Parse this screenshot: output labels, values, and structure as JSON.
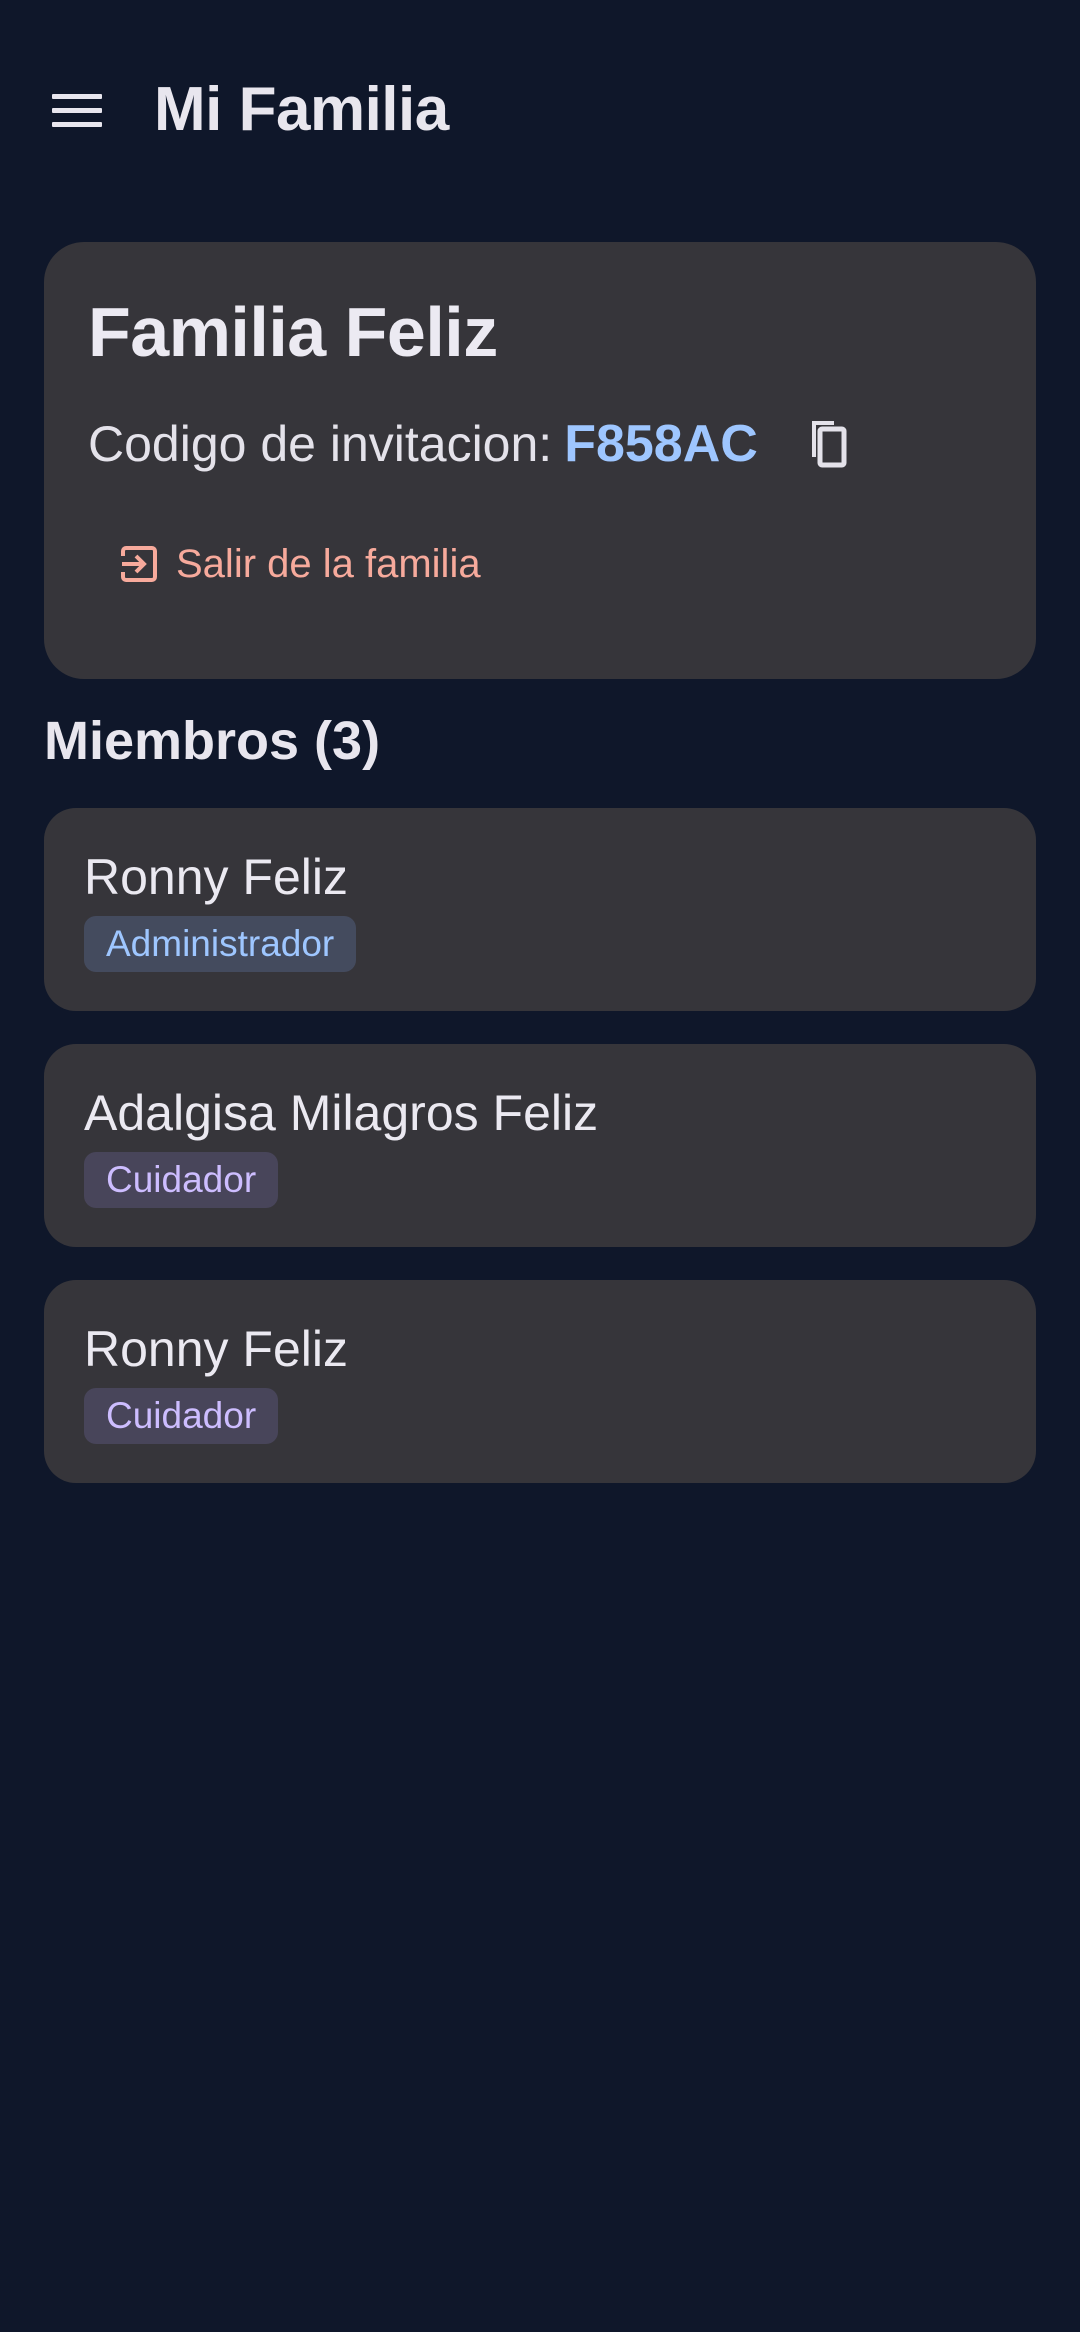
{
  "app_bar": {
    "menu_icon": "menu-icon",
    "title": "Mi Familia"
  },
  "family": {
    "name": "Familia Feliz",
    "invite_label": "Codigo de invitacion:",
    "invite_code": "F858AC",
    "copy_icon": "copy-icon",
    "leave_icon": "logout-icon",
    "leave_label": "Salir de la familia"
  },
  "members": {
    "heading": "Miembros (3)",
    "items": [
      {
        "name": "Ronny Feliz",
        "role": "Administrador",
        "role_type": "admin"
      },
      {
        "name": "Adalgisa Milagros Feliz",
        "role": "Cuidador",
        "role_type": "caregiver"
      },
      {
        "name": "Ronny Feliz",
        "role": "Cuidador",
        "role_type": "caregiver"
      }
    ]
  },
  "colors": {
    "background": "#0f172a",
    "card": "#36353a",
    "accent_code": "#9ec6ff",
    "leave_text": "#f7aa9c",
    "admin_badge_bg": "#444b5e",
    "admin_badge_text": "#9ec6ff",
    "caregiver_badge_bg": "#48455a",
    "caregiver_badge_text": "#cdbdff"
  }
}
